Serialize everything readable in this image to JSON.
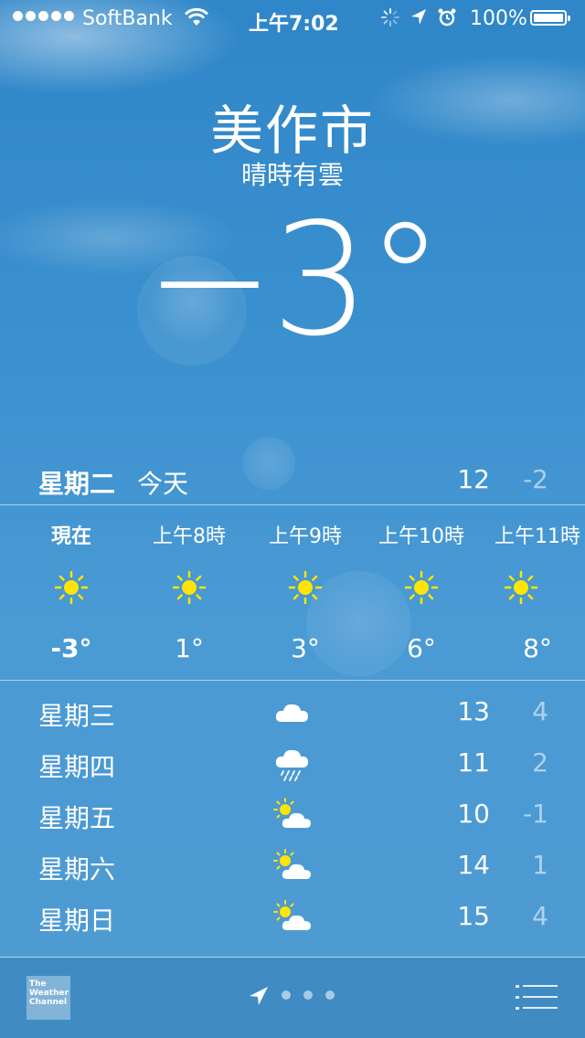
{
  "status_bar": {
    "carrier": "SoftBank",
    "time": "上午7:02",
    "battery": "100%",
    "battery_level": 1.0,
    "icons": [
      "signal-dots-icon",
      "wifi-icon",
      "activity-spinner-icon",
      "location-arrow-icon",
      "alarm-icon",
      "battery-icon"
    ]
  },
  "header": {
    "city": "美作市",
    "condition": "晴時有雲",
    "temperature": "−3°"
  },
  "today": {
    "day": "星期二",
    "label": "今天",
    "high": "12",
    "low": "-2"
  },
  "hourly": [
    {
      "time": "現在",
      "icon": "sun-icon",
      "temp": "-3°"
    },
    {
      "time": "上午8時",
      "icon": "sun-icon",
      "temp": "1°"
    },
    {
      "time": "上午9時",
      "icon": "sun-icon",
      "temp": "3°"
    },
    {
      "time": "上午10時",
      "icon": "sun-icon",
      "temp": "6°"
    },
    {
      "time": "上午11時",
      "icon": "sun-icon",
      "temp": "8°"
    }
  ],
  "daily": [
    {
      "day": "星期三",
      "icon": "cloud-icon",
      "high": "13",
      "low": "4"
    },
    {
      "day": "星期四",
      "icon": "rain-cloud-icon",
      "high": "11",
      "low": "2"
    },
    {
      "day": "星期五",
      "icon": "partly-cloudy-icon",
      "high": "10",
      "low": "-1"
    },
    {
      "day": "星期六",
      "icon": "partly-cloudy-icon",
      "high": "14",
      "low": "1"
    },
    {
      "day": "星期日",
      "icon": "partly-cloudy-icon",
      "high": "15",
      "low": "4"
    }
  ],
  "bottom_bar": {
    "logo_lines": [
      "The",
      "Weather",
      "Channel"
    ],
    "pages": 3
  },
  "colors": {
    "sky_top": "#2f86c8",
    "sky_bottom": "#4f9bd2",
    "sun": "#ffe500",
    "text": "#ffffff"
  }
}
